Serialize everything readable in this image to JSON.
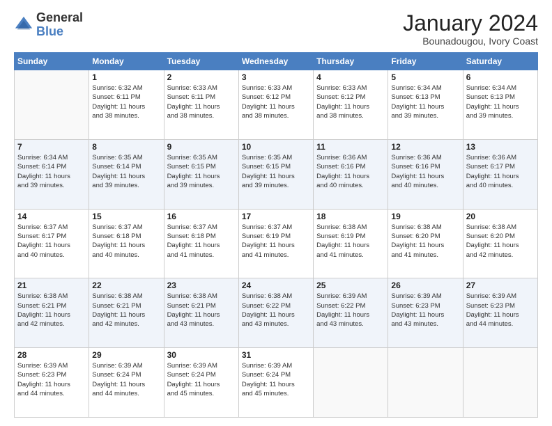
{
  "logo": {
    "general": "General",
    "blue": "Blue"
  },
  "title": "January 2024",
  "subtitle": "Bounadougou, Ivory Coast",
  "weekdays": [
    "Sunday",
    "Monday",
    "Tuesday",
    "Wednesday",
    "Thursday",
    "Friday",
    "Saturday"
  ],
  "weeks": [
    [
      {
        "day": "",
        "info": ""
      },
      {
        "day": "1",
        "info": "Sunrise: 6:32 AM\nSunset: 6:11 PM\nDaylight: 11 hours\nand 38 minutes."
      },
      {
        "day": "2",
        "info": "Sunrise: 6:33 AM\nSunset: 6:11 PM\nDaylight: 11 hours\nand 38 minutes."
      },
      {
        "day": "3",
        "info": "Sunrise: 6:33 AM\nSunset: 6:12 PM\nDaylight: 11 hours\nand 38 minutes."
      },
      {
        "day": "4",
        "info": "Sunrise: 6:33 AM\nSunset: 6:12 PM\nDaylight: 11 hours\nand 38 minutes."
      },
      {
        "day": "5",
        "info": "Sunrise: 6:34 AM\nSunset: 6:13 PM\nDaylight: 11 hours\nand 39 minutes."
      },
      {
        "day": "6",
        "info": "Sunrise: 6:34 AM\nSunset: 6:13 PM\nDaylight: 11 hours\nand 39 minutes."
      }
    ],
    [
      {
        "day": "7",
        "info": "Sunrise: 6:34 AM\nSunset: 6:14 PM\nDaylight: 11 hours\nand 39 minutes."
      },
      {
        "day": "8",
        "info": "Sunrise: 6:35 AM\nSunset: 6:14 PM\nDaylight: 11 hours\nand 39 minutes."
      },
      {
        "day": "9",
        "info": "Sunrise: 6:35 AM\nSunset: 6:15 PM\nDaylight: 11 hours\nand 39 minutes."
      },
      {
        "day": "10",
        "info": "Sunrise: 6:35 AM\nSunset: 6:15 PM\nDaylight: 11 hours\nand 39 minutes."
      },
      {
        "day": "11",
        "info": "Sunrise: 6:36 AM\nSunset: 6:16 PM\nDaylight: 11 hours\nand 40 minutes."
      },
      {
        "day": "12",
        "info": "Sunrise: 6:36 AM\nSunset: 6:16 PM\nDaylight: 11 hours\nand 40 minutes."
      },
      {
        "day": "13",
        "info": "Sunrise: 6:36 AM\nSunset: 6:17 PM\nDaylight: 11 hours\nand 40 minutes."
      }
    ],
    [
      {
        "day": "14",
        "info": "Sunrise: 6:37 AM\nSunset: 6:17 PM\nDaylight: 11 hours\nand 40 minutes."
      },
      {
        "day": "15",
        "info": "Sunrise: 6:37 AM\nSunset: 6:18 PM\nDaylight: 11 hours\nand 40 minutes."
      },
      {
        "day": "16",
        "info": "Sunrise: 6:37 AM\nSunset: 6:18 PM\nDaylight: 11 hours\nand 41 minutes."
      },
      {
        "day": "17",
        "info": "Sunrise: 6:37 AM\nSunset: 6:19 PM\nDaylight: 11 hours\nand 41 minutes."
      },
      {
        "day": "18",
        "info": "Sunrise: 6:38 AM\nSunset: 6:19 PM\nDaylight: 11 hours\nand 41 minutes."
      },
      {
        "day": "19",
        "info": "Sunrise: 6:38 AM\nSunset: 6:20 PM\nDaylight: 11 hours\nand 41 minutes."
      },
      {
        "day": "20",
        "info": "Sunrise: 6:38 AM\nSunset: 6:20 PM\nDaylight: 11 hours\nand 42 minutes."
      }
    ],
    [
      {
        "day": "21",
        "info": "Sunrise: 6:38 AM\nSunset: 6:21 PM\nDaylight: 11 hours\nand 42 minutes."
      },
      {
        "day": "22",
        "info": "Sunrise: 6:38 AM\nSunset: 6:21 PM\nDaylight: 11 hours\nand 42 minutes."
      },
      {
        "day": "23",
        "info": "Sunrise: 6:38 AM\nSunset: 6:21 PM\nDaylight: 11 hours\nand 43 minutes."
      },
      {
        "day": "24",
        "info": "Sunrise: 6:38 AM\nSunset: 6:22 PM\nDaylight: 11 hours\nand 43 minutes."
      },
      {
        "day": "25",
        "info": "Sunrise: 6:39 AM\nSunset: 6:22 PM\nDaylight: 11 hours\nand 43 minutes."
      },
      {
        "day": "26",
        "info": "Sunrise: 6:39 AM\nSunset: 6:23 PM\nDaylight: 11 hours\nand 43 minutes."
      },
      {
        "day": "27",
        "info": "Sunrise: 6:39 AM\nSunset: 6:23 PM\nDaylight: 11 hours\nand 44 minutes."
      }
    ],
    [
      {
        "day": "28",
        "info": "Sunrise: 6:39 AM\nSunset: 6:23 PM\nDaylight: 11 hours\nand 44 minutes."
      },
      {
        "day": "29",
        "info": "Sunrise: 6:39 AM\nSunset: 6:24 PM\nDaylight: 11 hours\nand 44 minutes."
      },
      {
        "day": "30",
        "info": "Sunrise: 6:39 AM\nSunset: 6:24 PM\nDaylight: 11 hours\nand 45 minutes."
      },
      {
        "day": "31",
        "info": "Sunrise: 6:39 AM\nSunset: 6:24 PM\nDaylight: 11 hours\nand 45 minutes."
      },
      {
        "day": "",
        "info": ""
      },
      {
        "day": "",
        "info": ""
      },
      {
        "day": "",
        "info": ""
      }
    ]
  ]
}
